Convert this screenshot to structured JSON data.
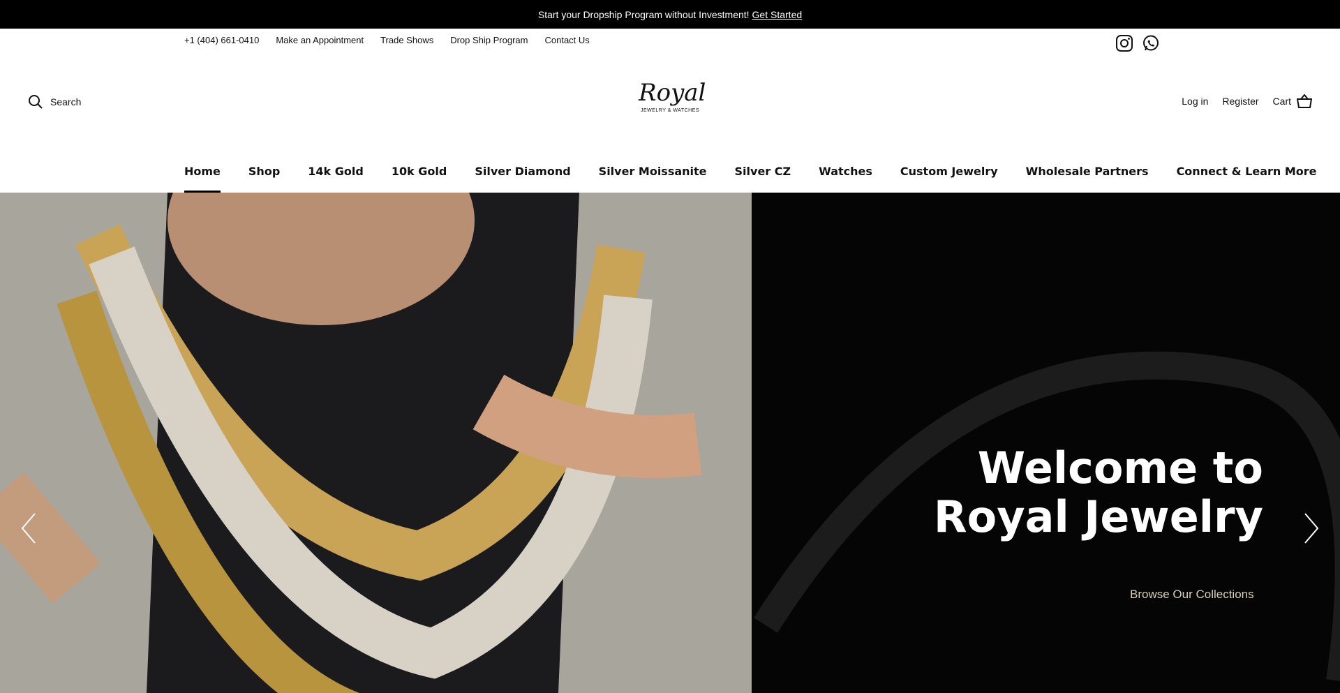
{
  "announcement": {
    "text": "Start your Dropship Program without Investment!",
    "cta": "Get Started"
  },
  "utility": {
    "links": [
      "+1 (404) 661-0410",
      "Make an Appointment",
      "Trade Shows",
      "Drop Ship Program",
      "Contact Us"
    ],
    "social": [
      "instagram-icon",
      "whatsapp-icon"
    ]
  },
  "header": {
    "search_label": "Search",
    "logo": {
      "brand": "Royal",
      "tagline": "JEWELRY & WATCHES"
    },
    "login": "Log in",
    "register": "Register",
    "cart": "Cart"
  },
  "nav": {
    "items": [
      "Home",
      "Shop",
      "14k Gold",
      "10k Gold",
      "Silver Diamond",
      "Silver Moissanite",
      "Silver CZ",
      "Watches",
      "Custom Jewelry",
      "Wholesale Partners",
      "Connect & Learn More"
    ],
    "active": "Home"
  },
  "hero": {
    "title_line1": "Welcome to",
    "title_line2": "Royal Jewelry",
    "cta": "Browse Our Collections"
  },
  "colors": {
    "announcement_bg": "#000000",
    "hero_right_bg": "#050505",
    "cta_text": "#d6d0b8"
  }
}
